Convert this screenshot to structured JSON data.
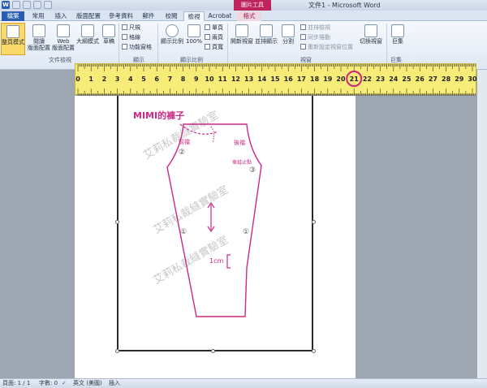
{
  "window": {
    "title": "文件1 - Microsoft Word",
    "contextual_tab_group": "圖片工具"
  },
  "quick_access": [
    "word-logo",
    "save-icon",
    "undo-icon",
    "redo-icon",
    "customize-icon"
  ],
  "tabs": [
    {
      "label": "檔案"
    },
    {
      "label": "常用"
    },
    {
      "label": "插入"
    },
    {
      "label": "版面配置"
    },
    {
      "label": "參考資料"
    },
    {
      "label": "郵件"
    },
    {
      "label": "校閱"
    },
    {
      "label": "檢視"
    },
    {
      "label": "Acrobat"
    },
    {
      "label": "格式"
    }
  ],
  "ribbon": {
    "doc_views": {
      "group_label": "文件檢視",
      "print_layout": "整頁模式",
      "full_screen_1": "閱讀",
      "full_screen_2": "全螢幕",
      "full_screen_3": "版面配置",
      "web_1": "Web",
      "web_2": "版面配置",
      "outline": "大綱模式",
      "draft": "草稿"
    },
    "show": {
      "group_label": "顯示",
      "ruler": "尺規",
      "gridlines": "格線",
      "nav_pane": "功能窗格"
    },
    "zoom": {
      "group_label": "顯示比例",
      "zoom": "顯示比例",
      "hundred": "100%",
      "one_page": "單頁",
      "two_pages": "兩頁",
      "page_width": "頁寬"
    },
    "window": {
      "group_label": "視窗",
      "new_window": "開新視窗",
      "arrange_all": "並排顯示",
      "split": "分割",
      "side_by_side": "並排檢視",
      "sync_scroll": "同步捲動",
      "reset_pos": "重新設定視窗位置",
      "switch_windows": "切換視窗"
    },
    "macros": {
      "group_label": "巨集",
      "macros": "巨集"
    }
  },
  "ruler": {
    "numbers": [
      "0",
      "1",
      "2",
      "3",
      "4",
      "5",
      "6",
      "7",
      "8",
      "9",
      "10",
      "11",
      "12",
      "13",
      "14",
      "15",
      "16",
      "17",
      "18",
      "19",
      "20",
      "21",
      "22",
      "23",
      "24",
      "25",
      "26",
      "27",
      "28",
      "29",
      "30"
    ],
    "highlighted": "21",
    "highlight_color": "#d4237a"
  },
  "pattern": {
    "title": "MIMI的褲子",
    "front_label": "前襠",
    "back_label": "後襠",
    "stop_label": "車縫止點",
    "num_2": "②",
    "num_3": "③",
    "num_1a": "①",
    "num_1b": "①",
    "seam_allowance": "1cm",
    "watermark": "艾莉私裁縫實驗室",
    "line_color": "#cc2a86"
  },
  "status_bar": {
    "page": "頁面: 1 / 1",
    "words": "字數: 0",
    "language": "英文 (美國)",
    "mode": "插入"
  }
}
